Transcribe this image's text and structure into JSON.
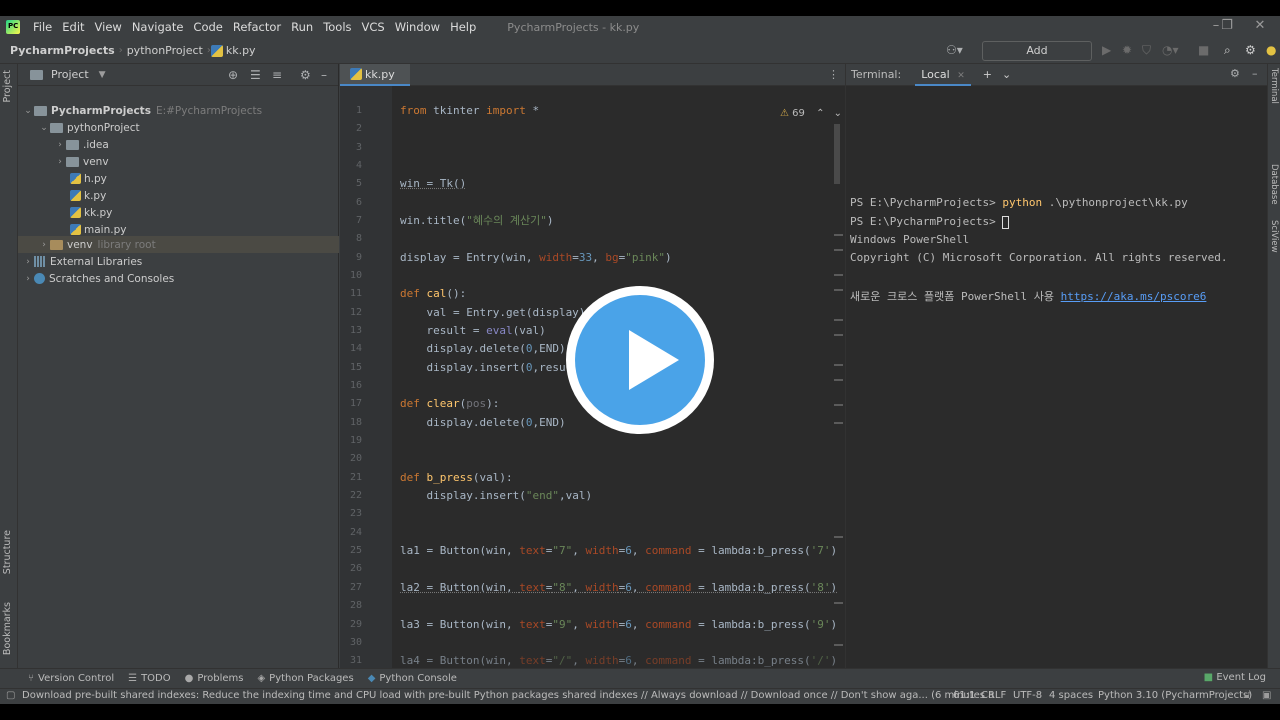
{
  "menu": {
    "items": [
      "File",
      "Edit",
      "View",
      "Navigate",
      "Code",
      "Refactor",
      "Run",
      "Tools",
      "VCS",
      "Window",
      "Help"
    ],
    "title": "PycharmProjects - kk.py"
  },
  "navbar": {
    "crumbs": [
      "PycharmProjects",
      "pythonProject",
      "kk.py"
    ],
    "add_config": "Add Configuration..."
  },
  "left_tabs": {
    "project": "Project",
    "structure": "Structure",
    "bookmarks": "Bookmarks"
  },
  "project_panel": {
    "title": "Project",
    "tree": [
      {
        "label": "PycharmProjects",
        "hint": "E:#PycharmProjects"
      },
      {
        "label": "pythonProject",
        "hint": ""
      },
      {
        "label": ".idea",
        "hint": ""
      },
      {
        "label": "venv",
        "hint": ""
      },
      {
        "label": "h.py",
        "hint": ""
      },
      {
        "label": "k.py",
        "hint": ""
      },
      {
        "label": "kk.py",
        "hint": ""
      },
      {
        "label": "main.py",
        "hint": ""
      },
      {
        "label": "venv",
        "hint": "library root"
      },
      {
        "label": "External Libraries",
        "hint": ""
      },
      {
        "label": "Scratches and Consoles",
        "hint": ""
      }
    ]
  },
  "editor": {
    "tab": "kk.py",
    "warnings": "69",
    "line_numbers": [
      "1",
      "2",
      "3",
      "4",
      "5",
      "6",
      "7",
      "8",
      "9",
      "10",
      "11",
      "12",
      "13",
      "14",
      "15",
      "16",
      "17",
      "18",
      "19",
      "20",
      "21",
      "22",
      "23",
      "24",
      "25",
      "26",
      "27",
      "28",
      "29",
      "30",
      "31"
    ],
    "lines": {
      "l1": [
        "from",
        " tkinter ",
        "import",
        " *"
      ],
      "l5": "win = Tk()",
      "l7": [
        "win.title(",
        "\"혜수의 계산기\"",
        ")"
      ],
      "l9": [
        "display = Entry(win, ",
        "width",
        "=",
        "33",
        ", ",
        "bg",
        "=",
        "\"pink\"",
        ")"
      ],
      "l11": [
        "def ",
        "cal",
        "():"
      ],
      "l12": "    val = Entry.get(display)",
      "l13": [
        "    result = ",
        "eval",
        "(val)"
      ],
      "l14": [
        "    display.delete(",
        "0",
        ",END)"
      ],
      "l15": [
        "    display.insert(",
        "0",
        ",resu"
      ],
      "l17": [
        "def ",
        "clear",
        "(",
        "pos",
        "):"
      ],
      "l18": [
        "    display.delete(",
        "0",
        ",END)"
      ],
      "l21": [
        "def ",
        "b_press",
        "(val):"
      ],
      "l22": [
        "    display.insert(",
        "\"end\"",
        ",val)"
      ],
      "l25": [
        "la1 = Button(win, ",
        "text",
        "=",
        "\"7\"",
        ", ",
        "width",
        "=",
        "6",
        ", ",
        "command",
        " = lambda:b_press(",
        "'7'",
        ")"
      ],
      "l27": [
        "la2 = Button(win, ",
        "text",
        "=",
        "\"8\"",
        ", ",
        "width",
        "=",
        "6",
        ", ",
        "command",
        " = lambda:b_press(",
        "'8'",
        ")"
      ],
      "l29": [
        "la3 = Button(win, ",
        "text",
        "=",
        "\"9\"",
        ", ",
        "width",
        "=",
        "6",
        ", ",
        "command",
        " = lambda:b_press(",
        "'9'",
        ")"
      ],
      "l31": [
        "la4 = Button(win, ",
        "text",
        "=",
        "\"/\"",
        ", ",
        "width",
        "=",
        "6",
        ", ",
        "command",
        " = lambda:b_press(",
        "'/'",
        ")"
      ]
    }
  },
  "terminal": {
    "label": "Terminal:",
    "tab": "Local",
    "lines": {
      "t1_prompt": "PS E:\\PycharmProjects> ",
      "t1_cmd": "python",
      "t1_arg": " .\\pythonproject\\kk.py",
      "t2_prompt": "PS E:\\PycharmProjects> ",
      "t3": "Windows PowerShell",
      "t4": "Copyright (C) Microsoft Corporation. All rights reserved.",
      "t5": "새로운 크로스 플랫폼 PowerShell 사용 ",
      "t5_link": "https://aka.ms/pscore6"
    }
  },
  "right_tabs": {
    "terminal": "Terminal",
    "database": "Database",
    "sciview": "SciView"
  },
  "toolbar": {
    "items": [
      "Version Control",
      "TODO",
      "Problems",
      "Python Packages",
      "Python Console"
    ],
    "event_log": "Event Log"
  },
  "status": {
    "message": "Download pre-built shared indexes: Reduce the indexing time and CPU load with pre-built Python packages shared indexes // Always download // Download once // Don't show aga... (6 minutes a",
    "position": "61:1",
    "line_sep": "CRLF",
    "encoding": "UTF-8",
    "indent": "4 spaces",
    "interpreter": "Python 3.10 (PycharmProjects)"
  },
  "colors": {
    "accent": "#4a88c7",
    "play_button": "#4aa3e8"
  }
}
